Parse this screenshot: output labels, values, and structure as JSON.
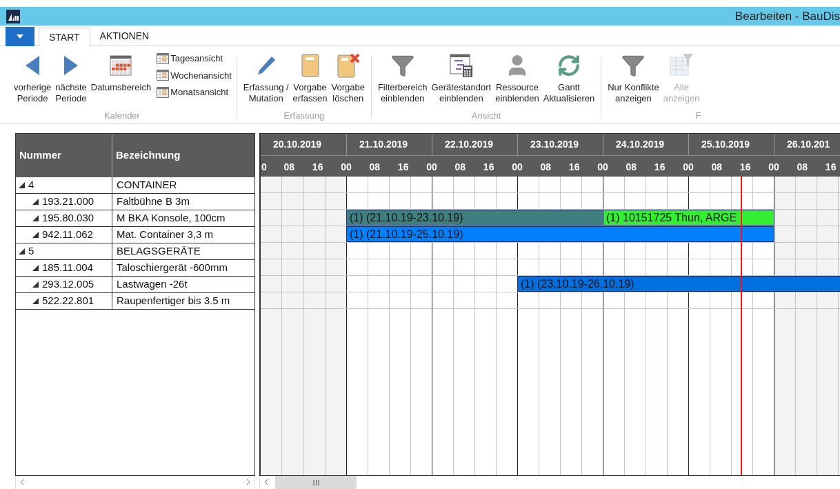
{
  "window": {
    "title": "Bearbeiten - BauDis"
  },
  "ribbon_tabs": [
    {
      "label": "START",
      "selected": true
    },
    {
      "label": "AKTIONEN",
      "selected": false
    }
  ],
  "ribbon_groups": [
    {
      "label": "Kalender",
      "items": [
        {
          "kind": "large",
          "lines": [
            "vorherige",
            "Periode"
          ],
          "disabled": false
        },
        {
          "kind": "large",
          "lines": [
            "nächste",
            "Periode"
          ],
          "disabled": false
        },
        {
          "kind": "large",
          "lines": [
            "Datumsbereich"
          ],
          "disabled": false
        },
        {
          "kind": "stack",
          "entries": [
            "Tagesansicht",
            "Wochenansicht",
            "Monatsansicht"
          ]
        }
      ]
    },
    {
      "label": "Erfassung",
      "items": [
        {
          "kind": "large",
          "lines": [
            "Erfassung /",
            "Mutation"
          ],
          "disabled": false
        },
        {
          "kind": "large",
          "lines": [
            "Vorgabe",
            "erfassen"
          ],
          "disabled": false
        },
        {
          "kind": "large",
          "lines": [
            "Vorgabe",
            "löschen"
          ],
          "disabled": false
        }
      ]
    },
    {
      "label": "Ansicht",
      "items": [
        {
          "kind": "large",
          "lines": [
            "Filterbereich",
            "einblenden"
          ],
          "disabled": false
        },
        {
          "kind": "large",
          "lines": [
            "Gerätestandort",
            "einblenden"
          ],
          "disabled": false
        },
        {
          "kind": "large",
          "lines": [
            "Ressource",
            "einblenden"
          ],
          "disabled": false
        },
        {
          "kind": "large",
          "lines": [
            "Gantt",
            "Aktualisieren"
          ],
          "disabled": false
        }
      ]
    },
    {
      "label": "F",
      "items": [
        {
          "kind": "large",
          "lines": [
            "Nur Konflikte",
            "anzeigen"
          ],
          "disabled": false
        },
        {
          "kind": "large",
          "lines": [
            "Alle",
            "anzeigen"
          ],
          "disabled": true
        }
      ]
    }
  ],
  "table": {
    "columns": [
      "Nummer",
      "Bezeichnung"
    ],
    "rows": [
      {
        "number": "4",
        "name": "CONTAINER",
        "expanded": true,
        "children": [
          {
            "number": "193.21.000",
            "name": "Faltbühne B 3m",
            "expanded": true
          },
          {
            "number": "195.80.030",
            "name": "M BKA Konsole, 100cm",
            "expanded": true,
            "bars": [
              {
                "label": "(1)  (21.10.19-23.10.19)",
                "color": "#407f7f"
              },
              {
                "label": "(1) 10151725 Thun, ARGE",
                "color": "#33ee33"
              }
            ]
          },
          {
            "number": "942.11.062",
            "name": "Mat. Container 3,3 m",
            "expanded": true,
            "bars": [
              {
                "label": "(1)  (21.10.19-25.10.19)",
                "color": "#0080ff"
              }
            ]
          }
        ]
      },
      {
        "number": "5",
        "name": "BELAGSGERÄTE",
        "expanded": true,
        "children": [
          {
            "number": "185.11.004",
            "name": "Taloschiergerät -600mm",
            "expanded": true
          },
          {
            "number": "293.12.005",
            "name": "Lastwagen -26t",
            "expanded": true,
            "bars": [
              {
                "label": "(1)  (23.10.19-26.10.19)",
                "color": "#0070e0"
              }
            ]
          },
          {
            "number": "522.22.801",
            "name": "Raupenfertiger bis 3.5 m",
            "expanded": true
          }
        ]
      }
    ]
  },
  "gantt": {
    "days": [
      {
        "date": "20.10.2019",
        "weekend": true,
        "hours": [
          "0",
          "08",
          "16"
        ]
      },
      {
        "date": "21.10.2019",
        "weekend": false,
        "hours": [
          "00",
          "08",
          "16"
        ]
      },
      {
        "date": "22.10.2019",
        "weekend": false,
        "hours": [
          "00",
          "08",
          "16"
        ]
      },
      {
        "date": "23.10.2019",
        "weekend": false,
        "hours": [
          "00",
          "08",
          "16"
        ]
      },
      {
        "date": "24.10.2019",
        "weekend": false,
        "hours": [
          "00",
          "08",
          "16"
        ]
      },
      {
        "date": "25.10.2019",
        "weekend": false,
        "hours": [
          "00",
          "08",
          "16"
        ]
      },
      {
        "date": "26.10.201",
        "weekend": true,
        "hours": [
          "00",
          "08",
          "16"
        ]
      }
    ],
    "now_marker": {
      "level": 0.828
    }
  }
}
